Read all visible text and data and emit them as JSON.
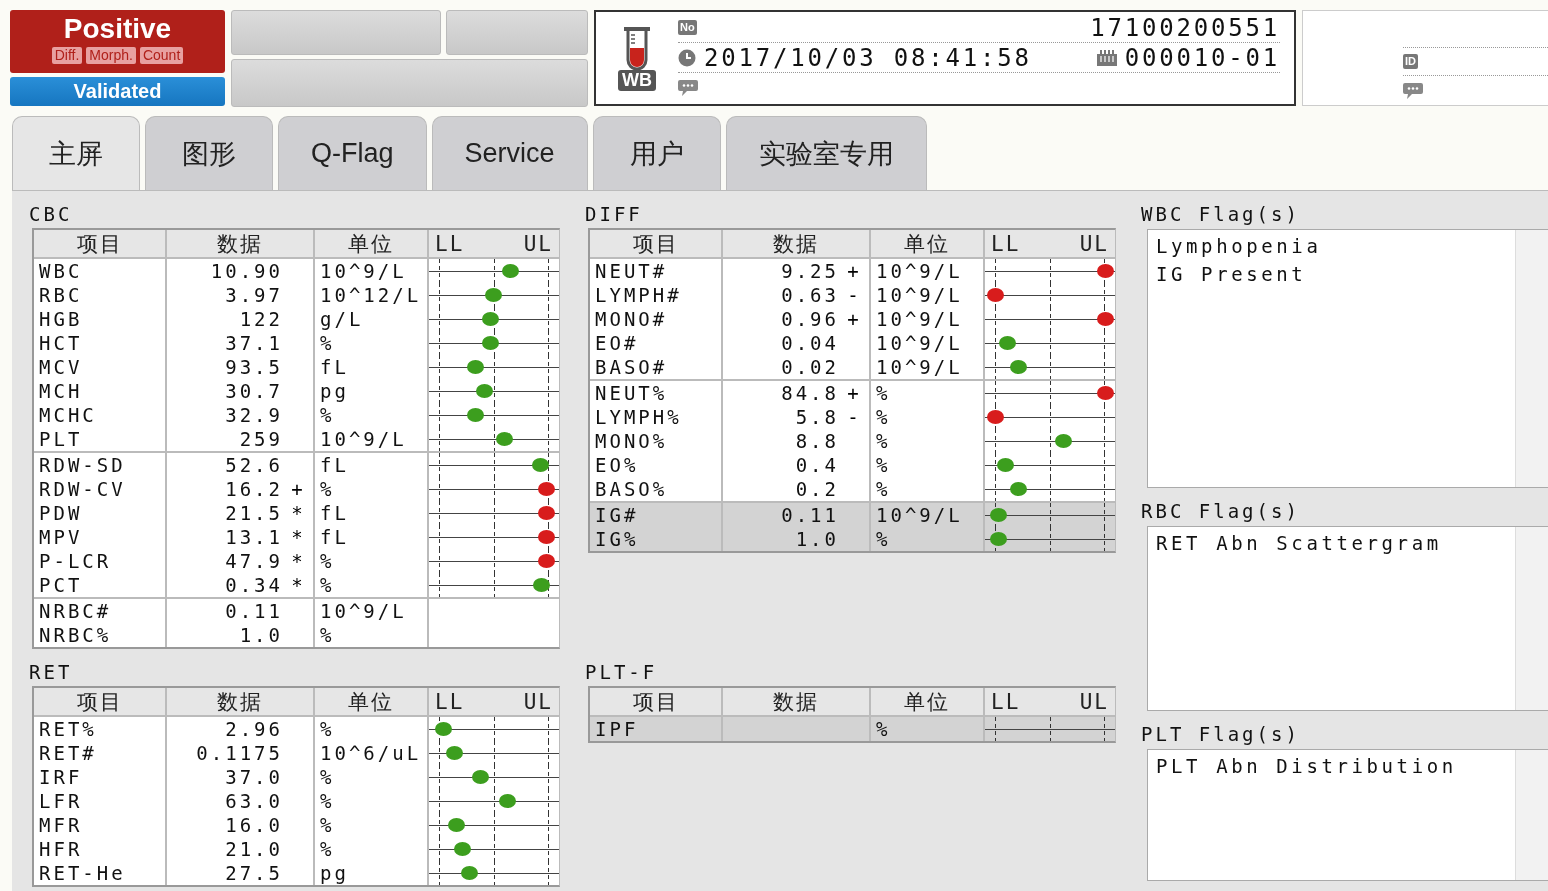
{
  "status": {
    "result": "Positive",
    "tags": [
      "Diff.",
      "Morph.",
      "Count"
    ],
    "validated": "Validated"
  },
  "sample": {
    "tube": "WB",
    "no_badge": "No",
    "number": "17100200551",
    "datetime": "2017/10/03 08:41:58",
    "rack": "000010-01"
  },
  "patient": {
    "id_badge": "ID"
  },
  "tabs": [
    {
      "label": "主屏",
      "selected": true
    },
    {
      "label": "图形",
      "selected": false
    },
    {
      "label": "Q-Flag",
      "selected": false
    },
    {
      "label": "Service",
      "selected": false
    },
    {
      "label": "用户",
      "selected": false
    },
    {
      "label": "实验室专用",
      "selected": false
    }
  ],
  "cbc": {
    "title": "CBC",
    "columns": [
      "项目",
      "数据",
      "单位",
      "LL",
      "UL"
    ],
    "groups": [
      {
        "rows": [
          {
            "item": "WBC",
            "value": "10.90",
            "unit": "10^9/L",
            "level": 0.62,
            "color": "#3c9e1e"
          },
          {
            "item": "RBC",
            "value": "3.97",
            "unit": "10^12/L",
            "level": 0.49,
            "color": "#3c9e1e"
          },
          {
            "item": "HGB",
            "value": "122",
            "unit": "g/L",
            "level": 0.47,
            "color": "#3c9e1e"
          },
          {
            "item": "HCT",
            "value": "37.1",
            "unit": "%",
            "level": 0.47,
            "color": "#3c9e1e"
          },
          {
            "item": "MCV",
            "value": "93.5",
            "unit": "fL",
            "level": 0.35,
            "color": "#3c9e1e"
          },
          {
            "item": "MCH",
            "value": "30.7",
            "unit": "pg",
            "level": 0.42,
            "color": "#3c9e1e"
          },
          {
            "item": "MCHC",
            "value": "32.9",
            "unit": "%",
            "level": 0.35,
            "color": "#3c9e1e"
          },
          {
            "item": "PLT",
            "value": "259",
            "unit": "10^9/L",
            "level": 0.58,
            "color": "#3c9e1e"
          }
        ]
      },
      {
        "rows": [
          {
            "item": "RDW-SD",
            "value": "52.6",
            "unit": "fL",
            "level": 0.85,
            "color": "#3c9e1e"
          },
          {
            "item": "RDW-CV",
            "value": "16.2",
            "flag": "+",
            "unit": "%",
            "level": 0.9,
            "color": "#d81c1c"
          },
          {
            "item": "PDW",
            "value": "21.5",
            "flag": "*",
            "unit": "fL",
            "level": 0.9,
            "color": "#d81c1c"
          },
          {
            "item": "MPV",
            "value": "13.1",
            "flag": "*",
            "unit": "fL",
            "level": 0.9,
            "color": "#d81c1c"
          },
          {
            "item": "P-LCR",
            "value": "47.9",
            "flag": "*",
            "unit": "%",
            "level": 0.9,
            "color": "#d81c1c"
          },
          {
            "item": "PCT",
            "value": "0.34",
            "flag": "*",
            "unit": "%",
            "level": 0.86,
            "color": "#3c9e1e"
          }
        ]
      },
      {
        "rows": [
          {
            "item": "NRBC#",
            "value": "0.11",
            "unit": "10^9/L"
          },
          {
            "item": "NRBC%",
            "value": "1.0",
            "unit": "%"
          }
        ]
      }
    ]
  },
  "ret": {
    "title": "RET",
    "columns": [
      "项目",
      "数据",
      "单位",
      "LL",
      "UL"
    ],
    "groups": [
      {
        "rows": [
          {
            "item": "RET%",
            "value": "2.96",
            "unit": "%",
            "level": 0.11,
            "color": "#3c9e1e"
          },
          {
            "item": "RET#",
            "value": "0.1175",
            "unit": "10^6/uL",
            "level": 0.19,
            "color": "#3c9e1e"
          },
          {
            "item": "IRF",
            "value": "37.0",
            "unit": "%",
            "level": 0.39,
            "color": "#3c9e1e"
          },
          {
            "item": "LFR",
            "value": "63.0",
            "unit": "%",
            "level": 0.6,
            "color": "#3c9e1e"
          },
          {
            "item": "MFR",
            "value": "16.0",
            "unit": "%",
            "level": 0.21,
            "color": "#3c9e1e"
          },
          {
            "item": "HFR",
            "value": "21.0",
            "unit": "%",
            "level": 0.25,
            "color": "#3c9e1e"
          },
          {
            "item": "RET-He",
            "value": "27.5",
            "unit": "pg",
            "level": 0.31,
            "color": "#3c9e1e"
          }
        ]
      }
    ]
  },
  "diff": {
    "title": "DIFF",
    "columns": [
      "项目",
      "数据",
      "单位",
      "LL",
      "UL"
    ],
    "groups": [
      {
        "rows": [
          {
            "item": "NEUT#",
            "value": "9.25",
            "flag": "+",
            "unit": "10^9/L",
            "level": 0.92,
            "color": "#d81c1c"
          },
          {
            "item": "LYMPH#",
            "value": "0.63",
            "flag": "-",
            "unit": "10^9/L",
            "level": 0.08,
            "color": "#d81c1c"
          },
          {
            "item": "MONO#",
            "value": "0.96",
            "flag": "+",
            "unit": "10^9/L",
            "level": 0.92,
            "color": "#d81c1c"
          },
          {
            "item": "EO#",
            "value": "0.04",
            "unit": "10^9/L",
            "level": 0.17,
            "color": "#3c9e1e"
          },
          {
            "item": "BASO#",
            "value": "0.02",
            "unit": "10^9/L",
            "level": 0.25,
            "color": "#3c9e1e"
          }
        ]
      },
      {
        "rows": [
          {
            "item": "NEUT%",
            "value": "84.8",
            "flag": "+",
            "unit": "%",
            "level": 0.92,
            "color": "#d81c1c"
          },
          {
            "item": "LYMPH%",
            "value": "5.8",
            "flag": "-",
            "unit": "%",
            "level": 0.08,
            "color": "#d81c1c"
          },
          {
            "item": "MONO%",
            "value": "8.8",
            "unit": "%",
            "level": 0.6,
            "color": "#3c9e1e"
          },
          {
            "item": "EO%",
            "value": "0.4",
            "unit": "%",
            "level": 0.15,
            "color": "#3c9e1e"
          },
          {
            "item": "BASO%",
            "value": "0.2",
            "unit": "%",
            "level": 0.25,
            "color": "#3c9e1e"
          }
        ]
      },
      {
        "rows": [
          {
            "item": "IG#",
            "value": "0.11",
            "unit": "10^9/L",
            "level": 0.1,
            "color": "#3c9e1e",
            "shaded": true
          },
          {
            "item": "IG%",
            "value": "1.0",
            "unit": "%",
            "level": 0.1,
            "color": "#3c9e1e",
            "shaded": true
          }
        ]
      }
    ]
  },
  "plt_f": {
    "title": "PLT-F",
    "columns": [
      "项目",
      "数据",
      "单位",
      "LL",
      "UL"
    ],
    "groups": [
      {
        "rows": [
          {
            "item": "IPF",
            "unit": "%",
            "scale": true,
            "shaded": true
          }
        ]
      }
    ]
  },
  "flags": [
    {
      "title": "WBC Flag(s)",
      "lines": [
        "Lymphopenia",
        "IG Present"
      ]
    },
    {
      "title": "RBC Flag(s)",
      "lines": [
        "RET Abn Scattergram"
      ]
    },
    {
      "title": "PLT Flag(s)",
      "lines": [
        "PLT Abn Distribution"
      ]
    }
  ]
}
